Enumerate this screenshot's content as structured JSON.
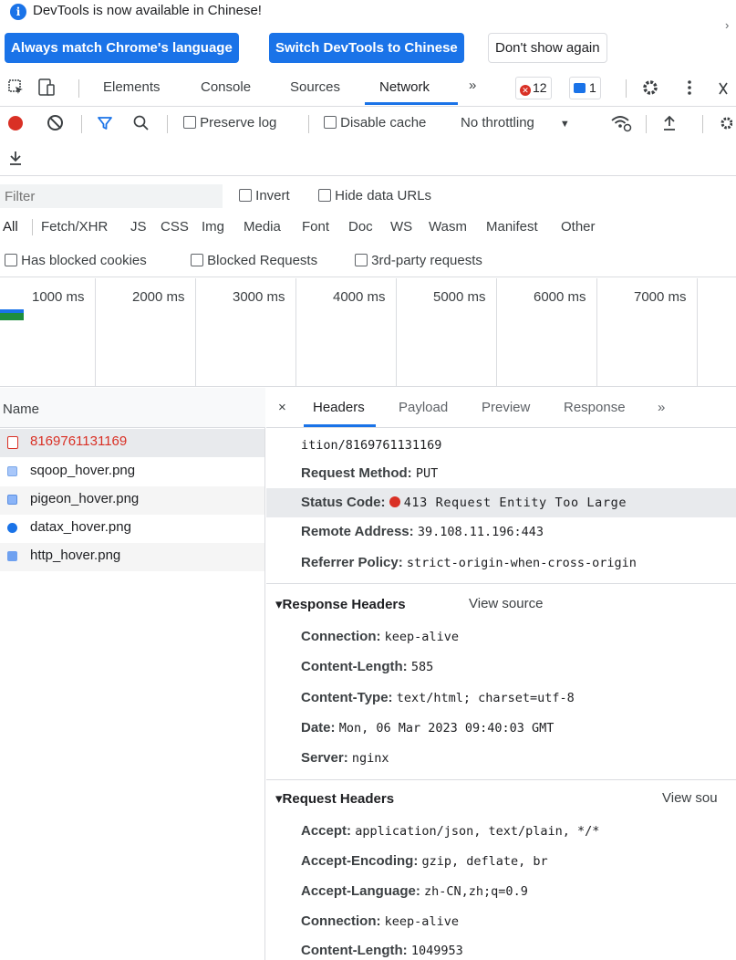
{
  "infobar": {
    "message": "DevTools is now available in Chinese!",
    "btn_match": "Always match Chrome's language",
    "btn_switch": "Switch DevTools to Chinese",
    "btn_dismiss": "Don't show again",
    "close": "›"
  },
  "tabs": {
    "elements": "Elements",
    "console": "Console",
    "sources": "Sources",
    "network": "Network",
    "more": "»",
    "errors_count": "12",
    "messages_count": "1"
  },
  "toolbar": {
    "preserve_log": "Preserve log",
    "disable_cache": "Disable cache",
    "throttling": "No throttling"
  },
  "filter": {
    "placeholder": "Filter",
    "invert": "Invert",
    "hide_data_urls": "Hide data URLs",
    "types": [
      "All",
      "Fetch/XHR",
      "JS",
      "CSS",
      "Img",
      "Media",
      "Font",
      "Doc",
      "WS",
      "Wasm",
      "Manifest",
      "Other"
    ],
    "has_blocked_cookies": "Has blocked cookies",
    "blocked_requests": "Blocked Requests",
    "third_party": "3rd-party requests"
  },
  "timeline": {
    "ticks": [
      "1000 ms",
      "2000 ms",
      "3000 ms",
      "4000 ms",
      "5000 ms",
      "6000 ms",
      "7000 ms"
    ]
  },
  "request_list": {
    "header": "Name",
    "rows": [
      {
        "name": "8169761131169"
      },
      {
        "name": "sqoop_hover.png"
      },
      {
        "name": "pigeon_hover.png"
      },
      {
        "name": "datax_hover.png"
      },
      {
        "name": "http_hover.png"
      }
    ]
  },
  "details": {
    "close": "×",
    "tabs": [
      "Headers",
      "Payload",
      "Preview",
      "Response",
      "»"
    ],
    "general": {
      "url_tail": "ition/8169761131169",
      "method_key": "Request Method:",
      "method_val": "PUT",
      "status_key": "Status Code:",
      "status_val": "413 Request Entity Too Large",
      "remote_key": "Remote Address:",
      "remote_val": "39.108.11.196:443",
      "referrer_key": "Referrer Policy:",
      "referrer_val": "strict-origin-when-cross-origin"
    },
    "response_headers": {
      "title": "▾Response Headers",
      "view_source": "View source",
      "items": [
        {
          "k": "Connection:",
          "v": "keep-alive"
        },
        {
          "k": "Content-Length:",
          "v": "585"
        },
        {
          "k": "Content-Type:",
          "v": "text/html; charset=utf-8"
        },
        {
          "k": "Date:",
          "v": "Mon, 06 Mar 2023 09:40:03 GMT"
        },
        {
          "k": "Server:",
          "v": "nginx"
        }
      ]
    },
    "request_headers": {
      "title": "▾Request Headers",
      "view_source": "View sou",
      "items": [
        {
          "k": "Accept:",
          "v": "application/json, text/plain, */*"
        },
        {
          "k": "Accept-Encoding:",
          "v": "gzip, deflate, br"
        },
        {
          "k": "Accept-Language:",
          "v": "zh-CN,zh;q=0.9"
        },
        {
          "k": "Connection:",
          "v": "keep-alive"
        },
        {
          "k": "Content-Length:",
          "v": "1049953"
        }
      ]
    }
  },
  "colors": {
    "accent": "#1a73e8",
    "error": "#d93025",
    "selected_request_text": "#d93025"
  }
}
